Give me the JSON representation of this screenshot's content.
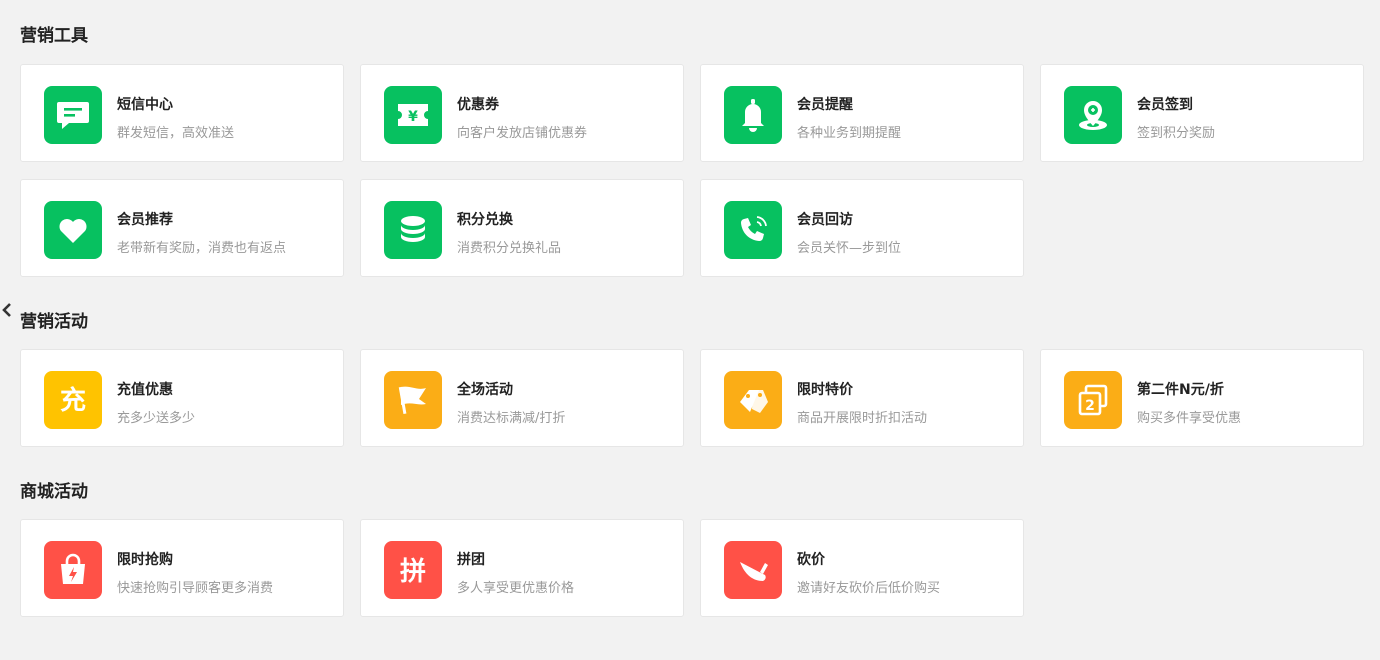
{
  "sections": [
    {
      "title": "营销工具",
      "cards": [
        {
          "title": "短信中心",
          "desc": "群发短信，高效准送",
          "icon": "sms-icon",
          "color": "#07c160"
        },
        {
          "title": "优惠券",
          "desc": "向客户发放店铺优惠券",
          "icon": "coupon-icon",
          "color": "#07c160"
        },
        {
          "title": "会员提醒",
          "desc": "各种业务到期提醒",
          "icon": "bell-icon",
          "color": "#07c160"
        },
        {
          "title": "会员签到",
          "desc": "签到积分奖励",
          "icon": "location-pin-icon",
          "color": "#07c160"
        },
        {
          "title": "会员推荐",
          "desc": "老带新有奖励，消费也有返点",
          "icon": "heart-icon",
          "color": "#07c160"
        },
        {
          "title": "积分兑换",
          "desc": "消费积分兑换礼品",
          "icon": "coin-stack-icon",
          "color": "#07c160"
        },
        {
          "title": "会员回访",
          "desc": "会员关怀—步到位",
          "icon": "phone-icon",
          "color": "#07c160"
        }
      ]
    },
    {
      "title": "营销活动",
      "cards": [
        {
          "title": "充值优惠",
          "desc": "充多少送多少",
          "icon": "recharge-icon",
          "color": "#ffc300",
          "glyph": "充"
        },
        {
          "title": "全场活动",
          "desc": "消费达标满减/打折",
          "icon": "flag-icon",
          "color": "#fbad16"
        },
        {
          "title": "限时特价",
          "desc": "商品开展限时折扣活动",
          "icon": "price-tag-icon",
          "color": "#fbad16"
        },
        {
          "title": "第二件N元/折",
          "desc": "购买多件享受优惠",
          "icon": "second-item-icon",
          "color": "#fbad16",
          "glyph": "2"
        }
      ]
    },
    {
      "title": "商城活动",
      "cards": [
        {
          "title": "限时抢购",
          "desc": "快速抢购引导顾客更多消费",
          "icon": "flash-sale-bag-icon",
          "color": "#ff5147"
        },
        {
          "title": "拼团",
          "desc": "多人享受更优惠价格",
          "icon": "group-buy-icon",
          "color": "#ff5147",
          "glyph": "拼"
        },
        {
          "title": "砍价",
          "desc": "邀请好友砍价后低价购买",
          "icon": "knife-icon",
          "color": "#ff5147"
        }
      ]
    }
  ]
}
